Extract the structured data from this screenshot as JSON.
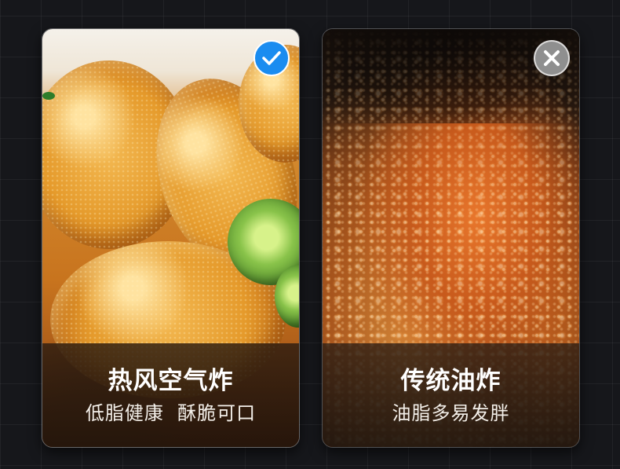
{
  "cards": [
    {
      "title": "热风空气炸",
      "subtitle": "低脂健康  酥脆可口",
      "badge": "check-icon",
      "badge_color": "#1a8cf0"
    },
    {
      "title": "传统油炸",
      "subtitle": "油脂多易发胖",
      "badge": "cross-icon",
      "badge_color": "#8a8a8a"
    }
  ]
}
